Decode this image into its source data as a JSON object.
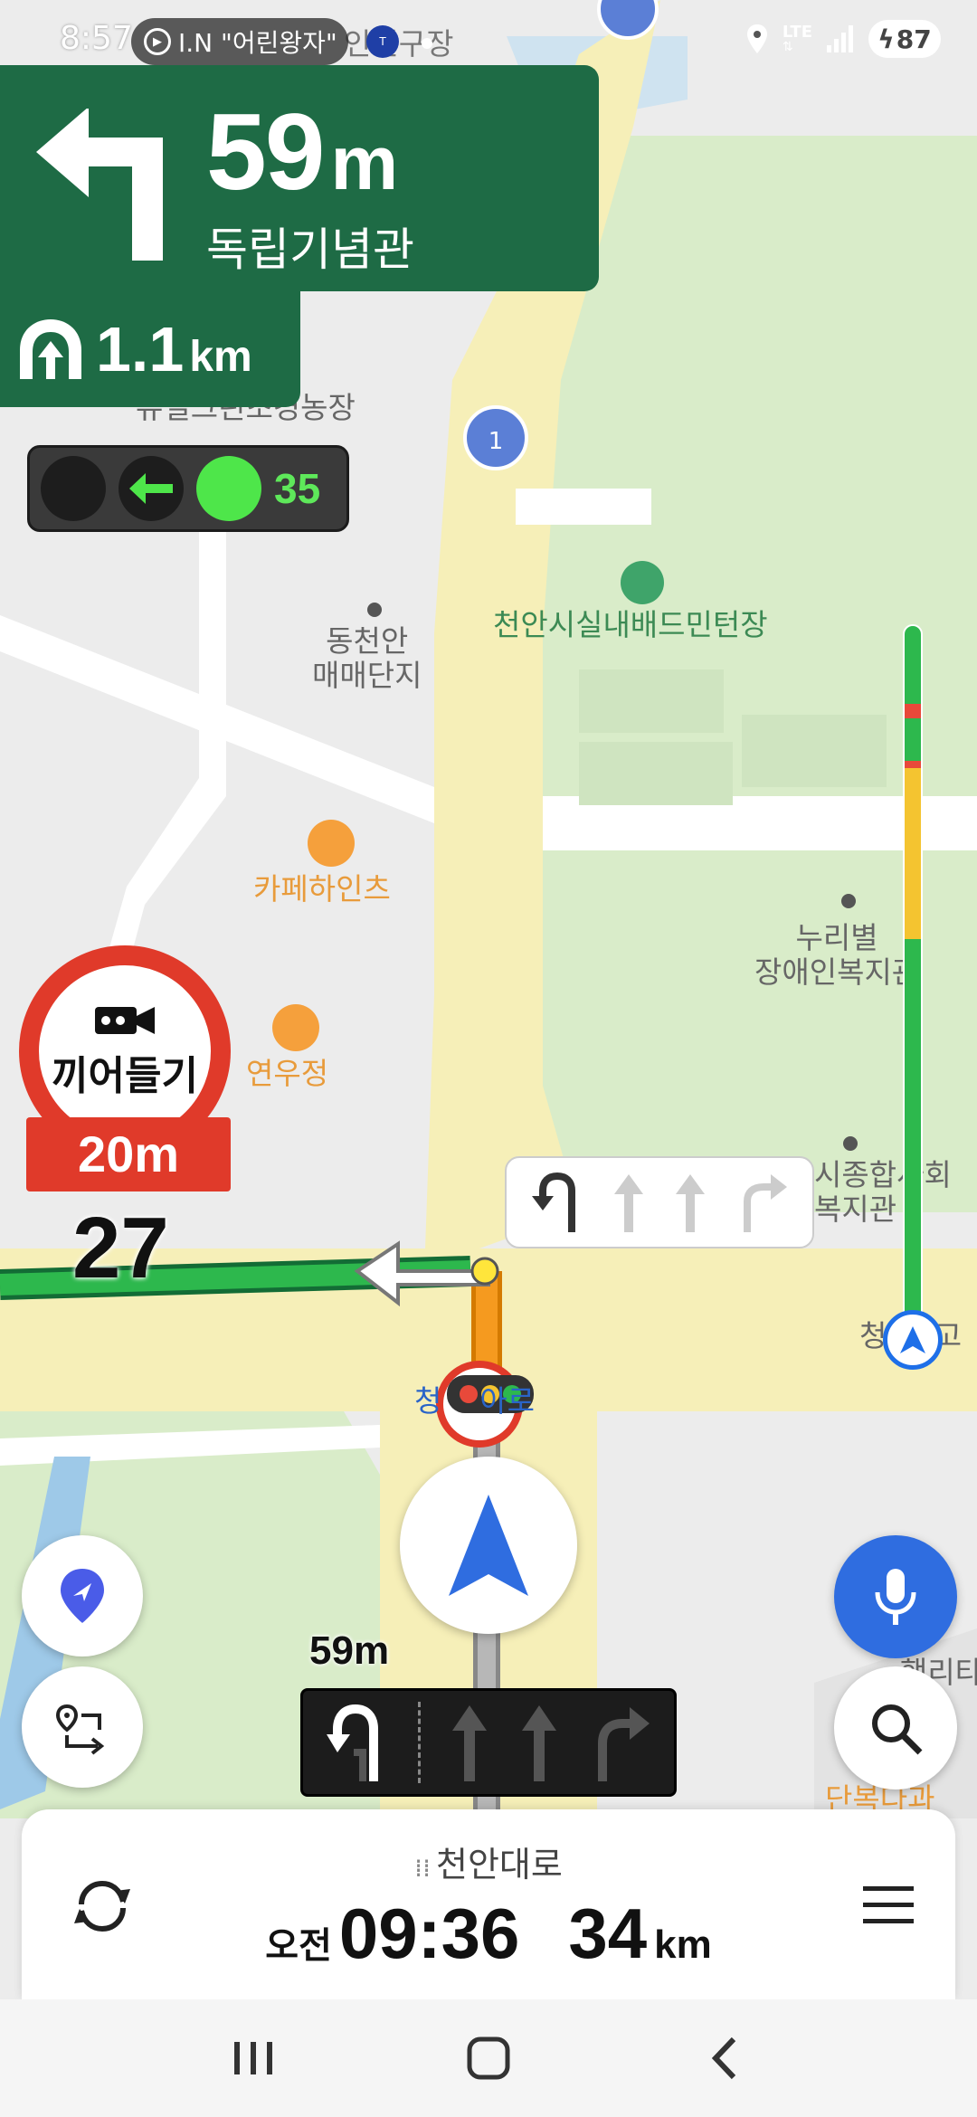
{
  "status_bar": {
    "time": "8:57",
    "music_title": "I.N \"어린왕자\"",
    "network": "LTE",
    "battery": "87"
  },
  "guidance": {
    "turn_icon": "turn-left-arrow-icon",
    "distance_value": "59",
    "distance_unit": "m",
    "destination": "독립기념관",
    "tunnel_icon": "tunnel-icon",
    "tunnel_distance_value": "1.1",
    "tunnel_distance_unit": "km"
  },
  "traffic_signal": {
    "countdown": "35",
    "active_color": "#4ee64a"
  },
  "camera": {
    "label": "끼어들기",
    "distance": "20m",
    "speed": "27"
  },
  "map": {
    "labels": {
      "farm": "유일그린조경농장",
      "dongcheonan": "동천안\n매매단지",
      "badminton": "천안시실내배드민턴장",
      "cafe": "카페하인츠",
      "yeonwoo": "연우정",
      "nuribyeol": "누리별\n장애인복지관",
      "sijong": "시종합사회\n복지관",
      "cheonga_ro": "청    아로",
      "cheong_right": "청     고",
      "danbok": "단복다과",
      "bottom_right": "행리타운",
      "top_partial": "인천구장"
    },
    "route_badge": "1",
    "route_color": "#2db84d"
  },
  "route_progress": {
    "segments": [
      {
        "color": "#2db84d",
        "portion": 0.11
      },
      {
        "color": "#e8493a",
        "portion": 0.02
      },
      {
        "color": "#2db84d",
        "portion": 0.06
      },
      {
        "color": "#e8493a",
        "portion": 0.01
      },
      {
        "color": "#f4c430",
        "portion": 0.24
      },
      {
        "color": "#2db84d",
        "portion": 0.56
      }
    ]
  },
  "lane_guide": {
    "distance": "59m"
  },
  "bottom_panel": {
    "road_icon": "road-icon",
    "road_name": "천안대로",
    "eta_prefix": "오전",
    "eta_time": "09:36",
    "remaining_value": "34",
    "remaining_unit": "km"
  }
}
